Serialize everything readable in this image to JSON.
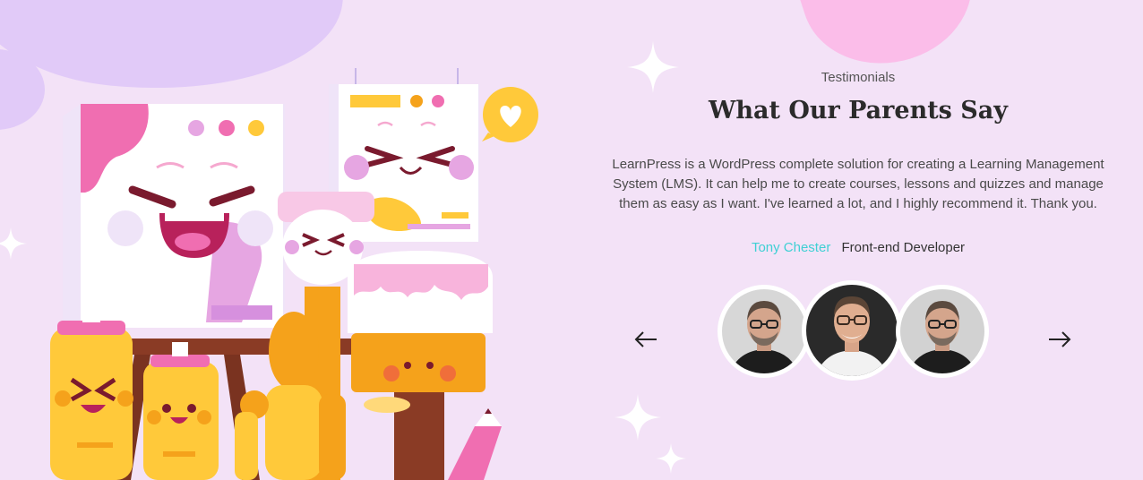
{
  "testimonials": {
    "eyebrow": "Testimonials",
    "title": "What Our Parents Say",
    "quote": "LearnPress is a WordPress complete solution for creating a Learning Management System (LMS). It can help me to create courses, lessons and quizzes and manage them as easy as I want. I've learned a lot, and I highly recommend it. Thank you.",
    "author_name": "Tony Chester",
    "author_role": "Front-end Developer",
    "prev_icon": "arrow-left-icon",
    "next_icon": "arrow-right-icon",
    "avatars": [
      "avatar",
      "avatar",
      "avatar"
    ]
  },
  "colors": {
    "background": "#f3e2f7",
    "author_name": "#3fd0d4",
    "title": "#2b2b2b",
    "blob_purple": "#e1caf8",
    "blob_pink": "#fbbde9"
  }
}
